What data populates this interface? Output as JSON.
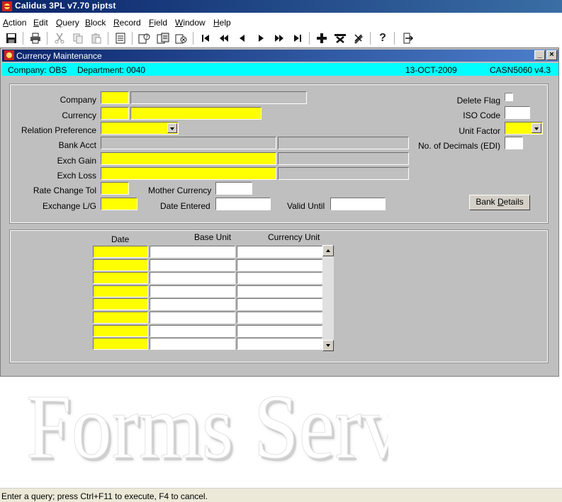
{
  "app": {
    "title": "Calidus 3PL v7.70 piptst",
    "colors": {
      "title_bar": "#0a246a",
      "context_bar": "#00ffff",
      "required_field": "#ffff00",
      "window_bg": "#bfbfbf"
    }
  },
  "menu": {
    "items": [
      "Action",
      "Edit",
      "Query",
      "Block",
      "Record",
      "Field",
      "Window",
      "Help"
    ]
  },
  "toolbar": {
    "icons": [
      "save-icon",
      "print-icon",
      "cut-icon",
      "copy-icon",
      "paste-icon",
      "list-icon",
      "query-enter-icon",
      "query-execute-icon",
      "query-cancel-icon",
      "first-record-icon",
      "previous-block-icon",
      "previous-record-icon",
      "next-record-icon",
      "next-block-icon",
      "last-record-icon",
      "insert-record-icon",
      "delete-record-icon",
      "clear-record-icon",
      "help-icon",
      "exit-icon"
    ],
    "help_glyph": "?"
  },
  "window": {
    "title": "Currency Maintenance",
    "minimize_glyph": "_",
    "close_glyph": "×",
    "context": {
      "company": "Company: OBS",
      "department": "Department: 0040",
      "date": "13-OCT-2009",
      "form_id": "CASN5060  v4.3"
    }
  },
  "form": {
    "labels": {
      "company": "Company",
      "currency": "Currency",
      "relation_preference": "Relation Preference",
      "bank_acct": "Bank Acct",
      "exch_gain": "Exch Gain",
      "exch_loss": "Exch Loss",
      "rate_change_tol": "Rate Change Tol",
      "mother_currency": "Mother Currency",
      "exchange_lg": "Exchange L/G",
      "date_entered": "Date Entered",
      "valid_until": "Valid Until",
      "delete_flag": "Delete Flag",
      "iso_code": "ISO Code",
      "unit_factor": "Unit Factor",
      "no_of_decimals": "No. of Decimals (EDI)"
    },
    "bank_details_button": {
      "prefix": "Bank ",
      "underlined": "D",
      "suffix": "etails"
    }
  },
  "grid": {
    "columns": [
      "Date",
      "Base Unit",
      "Currency Unit"
    ],
    "row_count": 8
  },
  "watermark": "Forms Services",
  "status": "Enter a query;  press Ctrl+F11 to execute, F4 to cancel."
}
